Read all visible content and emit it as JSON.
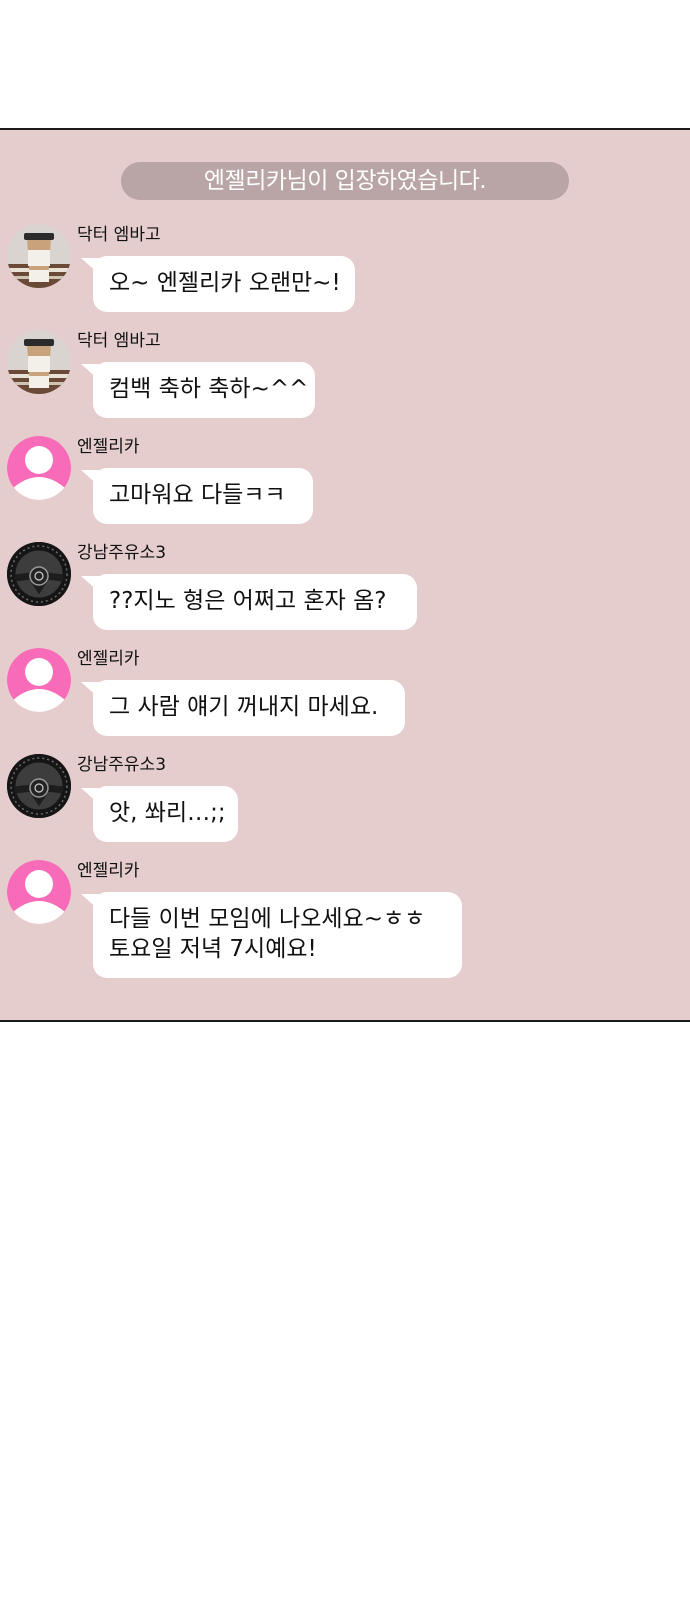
{
  "chat": {
    "notice": "엔젤리카님이 입장하였습니다.",
    "messages": [
      {
        "sender": "닥터 엠바고",
        "avatar": "coffee-cup-icon",
        "lines": [
          "오~ 엔젤리카 오랜만~!"
        ]
      },
      {
        "sender": "닥터 엠바고",
        "avatar": "coffee-cup-icon",
        "lines": [
          "컴백 축하 축하~^^"
        ]
      },
      {
        "sender": "엔젤리카",
        "avatar": "default-profile-icon",
        "lines": [
          "고마워요 다들ㅋㅋ"
        ]
      },
      {
        "sender": "강남주유소3",
        "avatar": "steering-wheel-icon",
        "lines": [
          "??지노 형은 어쩌고 혼자 옴?"
        ]
      },
      {
        "sender": "엔젤리카",
        "avatar": "default-profile-icon",
        "lines": [
          "그 사람 얘기 꺼내지 마세요."
        ]
      },
      {
        "sender": "강남주유소3",
        "avatar": "steering-wheel-icon",
        "lines": [
          "앗, 쏴리…;;"
        ]
      },
      {
        "sender": "엔젤리카",
        "avatar": "default-profile-icon",
        "lines": [
          "다들 이번 모임에 나오세요~ㅎㅎ",
          "토요일 저녁 7시예요!"
        ]
      }
    ]
  },
  "colors": {
    "panel_bg": "#e5cdce",
    "notice_bg": "#b9a5a6",
    "profile_pink": "#f76bb8",
    "bubble_bg": "#ffffff"
  }
}
